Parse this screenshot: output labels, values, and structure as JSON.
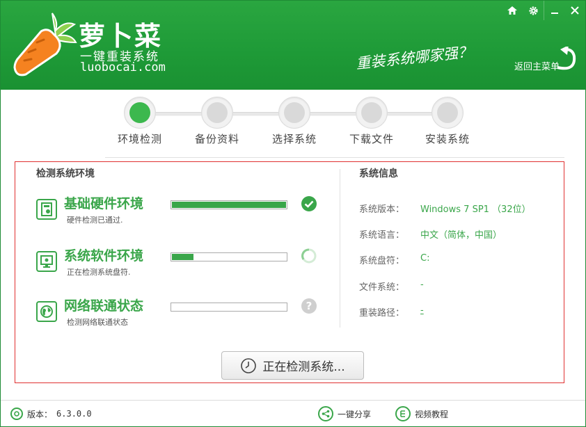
{
  "header": {
    "title": "萝卜菜",
    "subtitle": "一键重装系统",
    "url": "luobocai.com",
    "slogan": "重装系统哪家强？",
    "back_label": "返回主菜单",
    "brand_color": "#1e9a37",
    "controls": [
      {
        "name": "home",
        "icon": "home-icon"
      },
      {
        "name": "settings",
        "icon": "gear-icon"
      },
      {
        "name": "minimize",
        "icon": "minimize-icon"
      },
      {
        "name": "close",
        "icon": "close-icon"
      }
    ]
  },
  "steps": [
    {
      "label": "环境检测",
      "active": true
    },
    {
      "label": "备份资料",
      "active": false
    },
    {
      "label": "选择系统",
      "active": false
    },
    {
      "label": "下载文件",
      "active": false
    },
    {
      "label": "安装系统",
      "active": false
    }
  ],
  "detect": {
    "title": "检测系统环境",
    "items": [
      {
        "name": "基础硬件环境",
        "desc": "硬件检测已通过.",
        "progress": 1.0,
        "status": "done",
        "icon": "hardware-icon"
      },
      {
        "name": "系统软件环境",
        "desc": "正在检测系统盘符.",
        "progress": 0.19,
        "status": "loading",
        "icon": "monitor-icon"
      },
      {
        "name": "网络联通状态",
        "desc": "检测网络联通状态",
        "progress": 0.0,
        "status": "pending",
        "icon": "globe-icon"
      }
    ]
  },
  "sysinfo": {
    "title": "系统信息",
    "rows": [
      {
        "label": "系统版本：",
        "value": "Windows 7 SP1 （32位）"
      },
      {
        "label": "系统语言：",
        "value": "中文（简体，中国）"
      },
      {
        "label": "系统盘符：",
        "value": "C:"
      },
      {
        "label": "文件系统：",
        "value": "-"
      },
      {
        "label": "重装路径：",
        "value": "-"
      }
    ]
  },
  "detect_button": {
    "label": "正在检测系统..."
  },
  "footer": {
    "version_label": "版本：",
    "version_value": "6.3.0.0",
    "share_label": "一键分享",
    "tutorial_label": "视频教程"
  },
  "colors": {
    "accent": "#3aa64a",
    "panel_border": "#e03030"
  }
}
